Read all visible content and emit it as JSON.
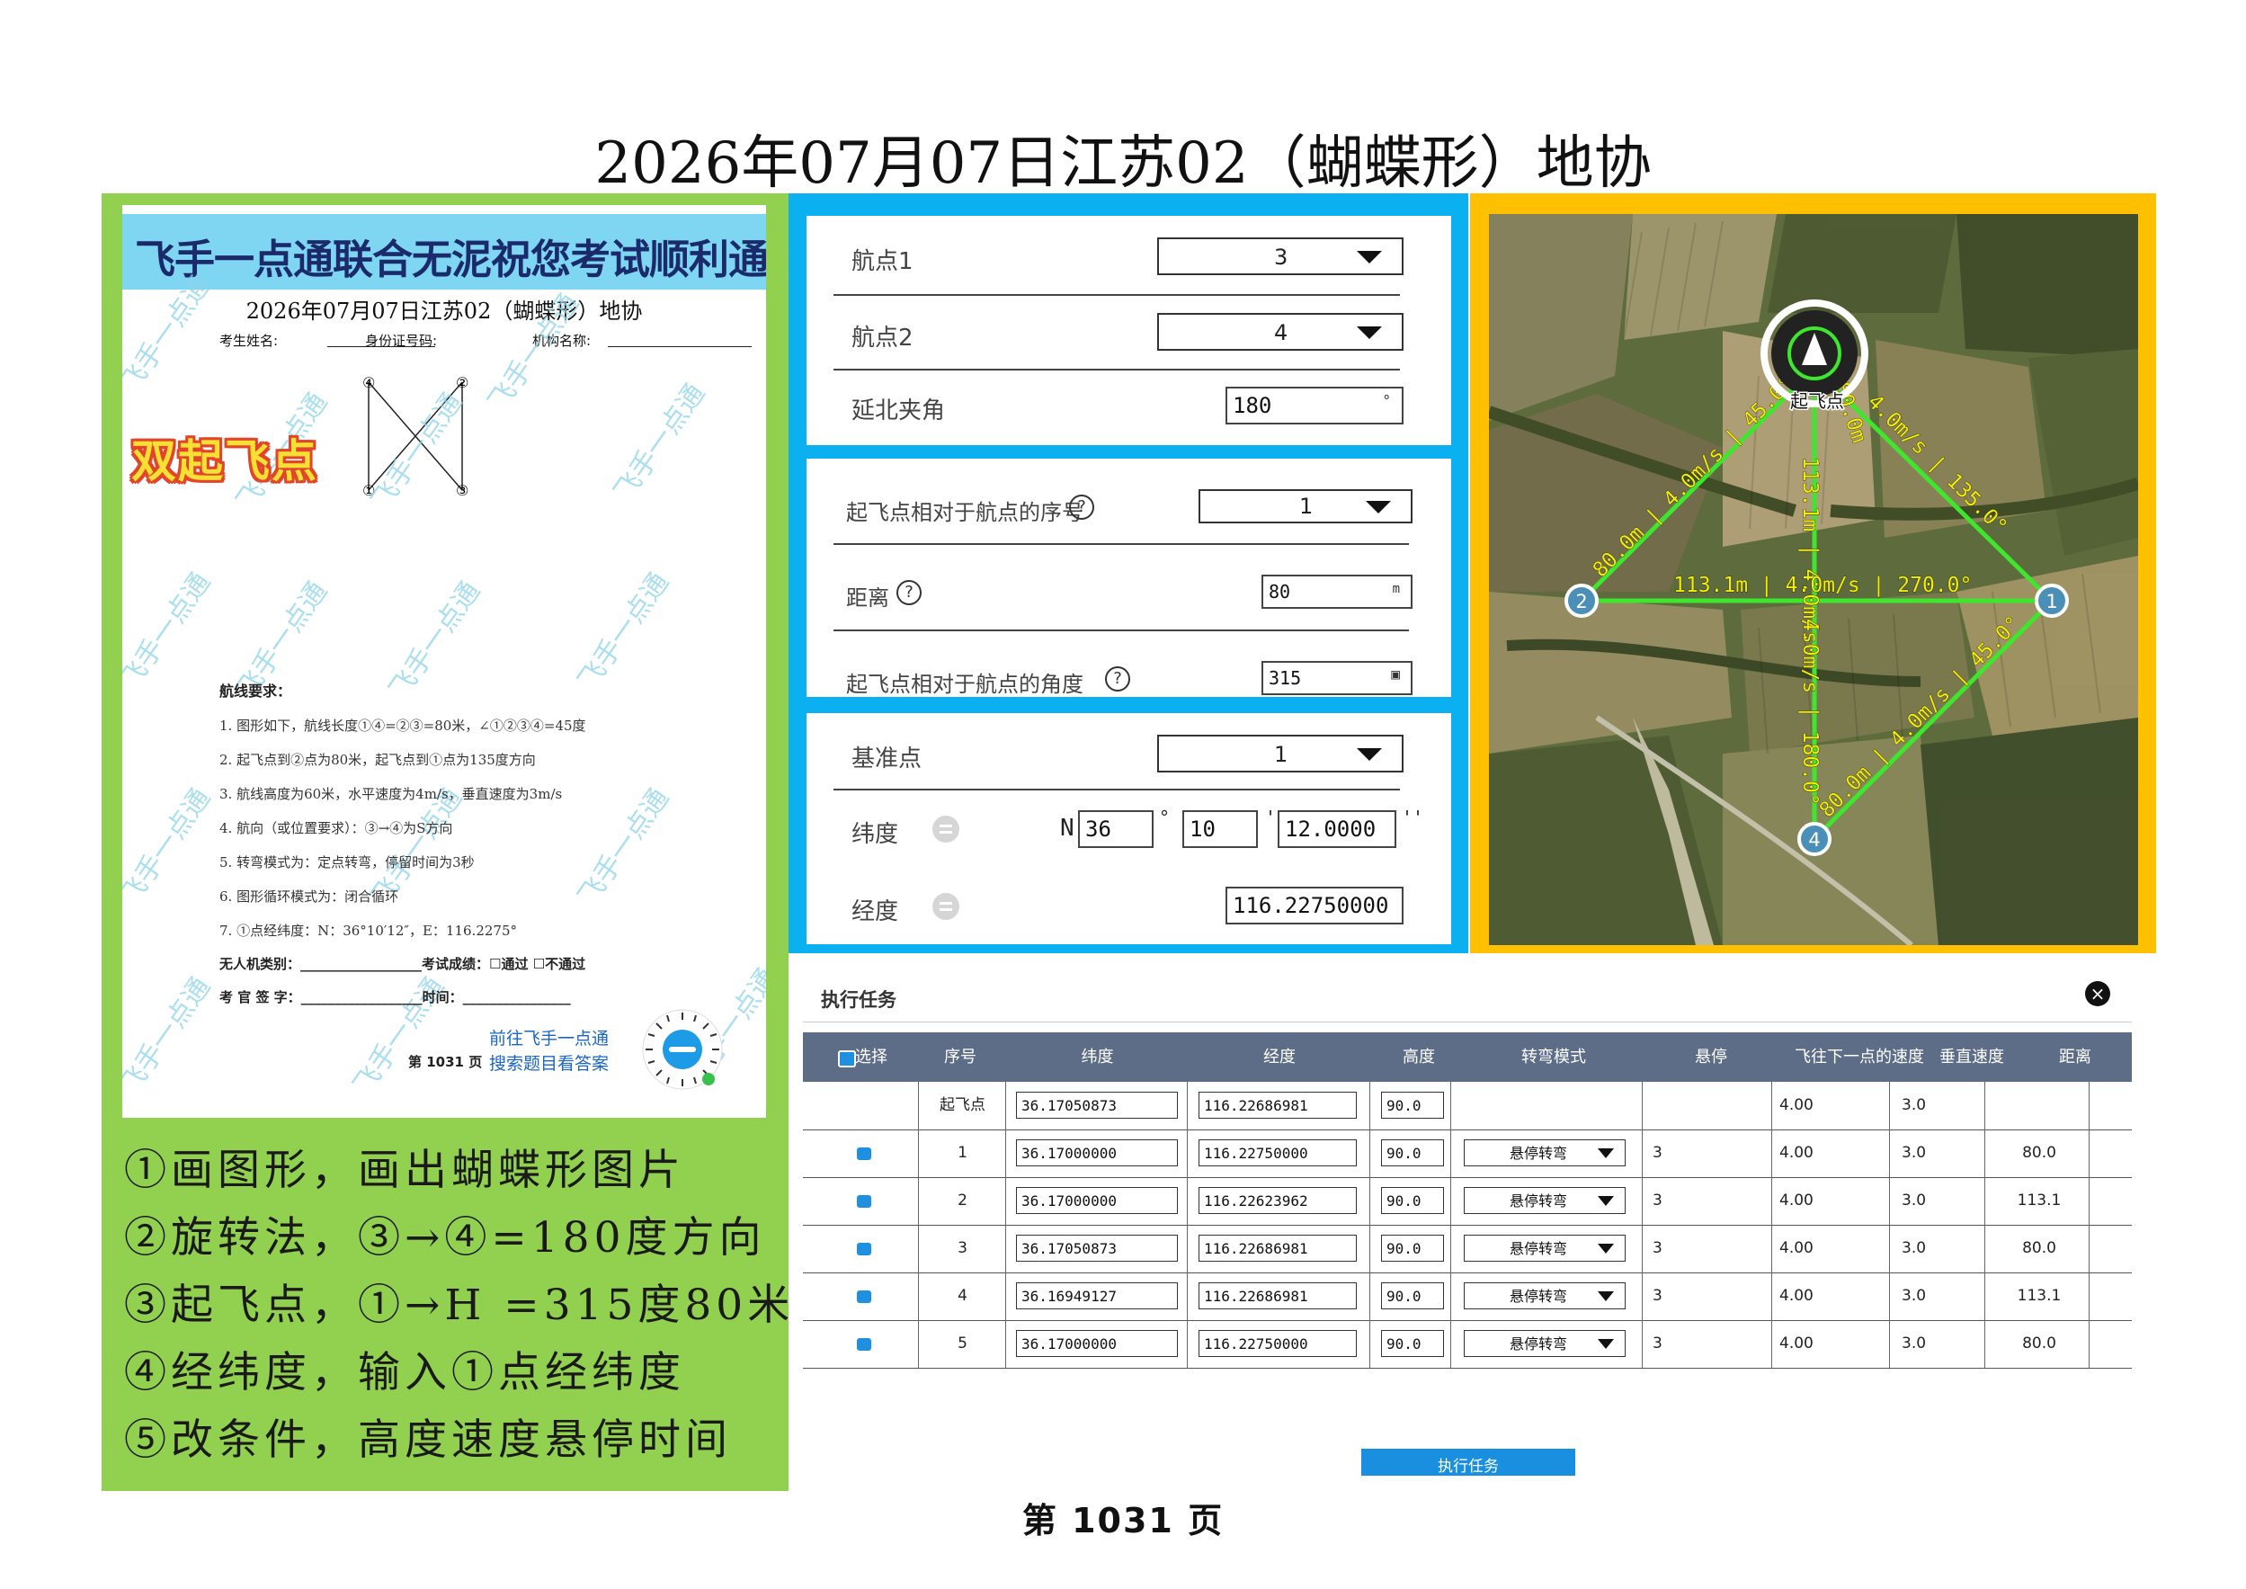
{
  "title": "2026年07月07日江苏02（蝴蝶形）地协",
  "paper": {
    "banner": "飞手一点通联合无泥祝您考试顺利通过",
    "title": "2026年07月07日江苏02（蝴蝶形）地协",
    "fields": {
      "name": "考生姓名:",
      "id": "身份证号码:",
      "org": "机构名称:"
    },
    "double_start": "双起飞点",
    "diagram_labels": [
      "④",
      "②",
      "①",
      "③"
    ],
    "watermark": "飞手一点通",
    "requirements_title": "航线要求：",
    "requirements": [
      "1. 图形如下，航线长度①④=②③=80米，∠①②③④=45度",
      "2. 起飞点到②点为80米，起飞点到①点为135度方向",
      "3. 航线高度为60米，水平速度为4m/s，垂直速度为3m/s",
      "4. 航向（或位置要求）：③→④为S方向",
      "5. 转弯模式为：定点转弯，停留时间为3秒",
      "6. 图形循环模式为：闭合循环",
      "7. ①点经纬度：N：36°10′12″，E：116.2275°"
    ],
    "exam_line1": "无人机类别：__________________考试成绩：☐通过  ☐不通过",
    "exam_line2": "考 官 签 字：__________________时间：________________",
    "qr_caption_1": "前往飞手一点通",
    "qr_caption_2": "搜索题目看答案",
    "page": "第 1031 页"
  },
  "steps": [
    "①画图形，画出蝴蝶形图片",
    "②旋转法，③→④=180度方向",
    "③起飞点，①→H =315度80米",
    "④经纬度，输入①点经纬度",
    "⑤改条件，高度速度悬停时间"
  ],
  "settings": {
    "waypoint1_label": "航点1",
    "waypoint1_value": "3",
    "waypoint2_label": "航点2",
    "waypoint2_value": "4",
    "north_angle_label": "延北夹角",
    "north_angle_value": "180",
    "north_angle_unit": "°",
    "takeoff_index_label": "起飞点相对于航点的序号",
    "takeoff_index_value": "1",
    "distance_label": "距离",
    "distance_value": "80",
    "distance_unit": "m",
    "takeoff_angle_label": "起飞点相对于航点的角度",
    "takeoff_angle_value": "315",
    "ref_label": "基准点",
    "ref_value": "1",
    "lat_label": "纬度",
    "lat_hemi": "N",
    "lat_deg": "36",
    "lat_min": "10",
    "lat_sec": "12.0000",
    "deg_sym": "°",
    "min_sym": "'",
    "sec_sym": "''",
    "lon_label": "经度",
    "lon_value": "116.22750000"
  },
  "map": {
    "takeoff_label": "起飞点",
    "points": [
      "1",
      "2",
      "3",
      "4"
    ],
    "seg_2_to_takeoff": "80.0m | 4.0m/s | 45.0°",
    "seg_takeoff_to_1": "4.0m/s | 135.0°",
    "seg_takeoff_top": "80.0m",
    "seg_vertical_top": "113.1m | 4.0m/s",
    "seg_horizontal": "113.1m | 4.0m/s | 270.0°",
    "seg_vertical_bottom": "4.0m/s | 180.0°",
    "seg_4_to_1": "80.0m | 4.0m/s | 45.0°"
  },
  "task": {
    "title": "执行任务",
    "columns": [
      "选择",
      "序号",
      "纬度",
      "经度",
      "高度",
      "转弯模式",
      "悬停",
      "飞往下一点的速度",
      "垂直速度",
      "距离"
    ],
    "rows": [
      {
        "seq": "起飞点",
        "lat": "36.17050873",
        "lon": "116.22686981",
        "alt": "90.0",
        "turn": "",
        "hover": "",
        "speed": "4.00",
        "vspeed": "3.0",
        "dist": ""
      },
      {
        "seq": "1",
        "lat": "36.17000000",
        "lon": "116.22750000",
        "alt": "90.0",
        "turn": "悬停转弯",
        "hover": "3",
        "speed": "4.00",
        "vspeed": "3.0",
        "dist": "80.0"
      },
      {
        "seq": "2",
        "lat": "36.17000000",
        "lon": "116.22623962",
        "alt": "90.0",
        "turn": "悬停转弯",
        "hover": "3",
        "speed": "4.00",
        "vspeed": "3.0",
        "dist": "113.1"
      },
      {
        "seq": "3",
        "lat": "36.17050873",
        "lon": "116.22686981",
        "alt": "90.0",
        "turn": "悬停转弯",
        "hover": "3",
        "speed": "4.00",
        "vspeed": "3.0",
        "dist": "80.0"
      },
      {
        "seq": "4",
        "lat": "36.16949127",
        "lon": "116.22686981",
        "alt": "90.0",
        "turn": "悬停转弯",
        "hover": "3",
        "speed": "4.00",
        "vspeed": "3.0",
        "dist": "113.1"
      },
      {
        "seq": "5",
        "lat": "36.17000000",
        "lon": "116.22750000",
        "alt": "90.0",
        "turn": "悬停转弯",
        "hover": "3",
        "speed": "4.00",
        "vspeed": "3.0",
        "dist": "80.0"
      }
    ],
    "execute_label": "执行任务"
  },
  "page_number": "第 1031 页",
  "colors": {
    "green_panel": "#92d050",
    "blue_panel": "#0ab0f0",
    "map_frame": "#ffc000",
    "route": "#3ee62e",
    "route_label": "#f5f000",
    "table_header": "#5d6c87"
  }
}
